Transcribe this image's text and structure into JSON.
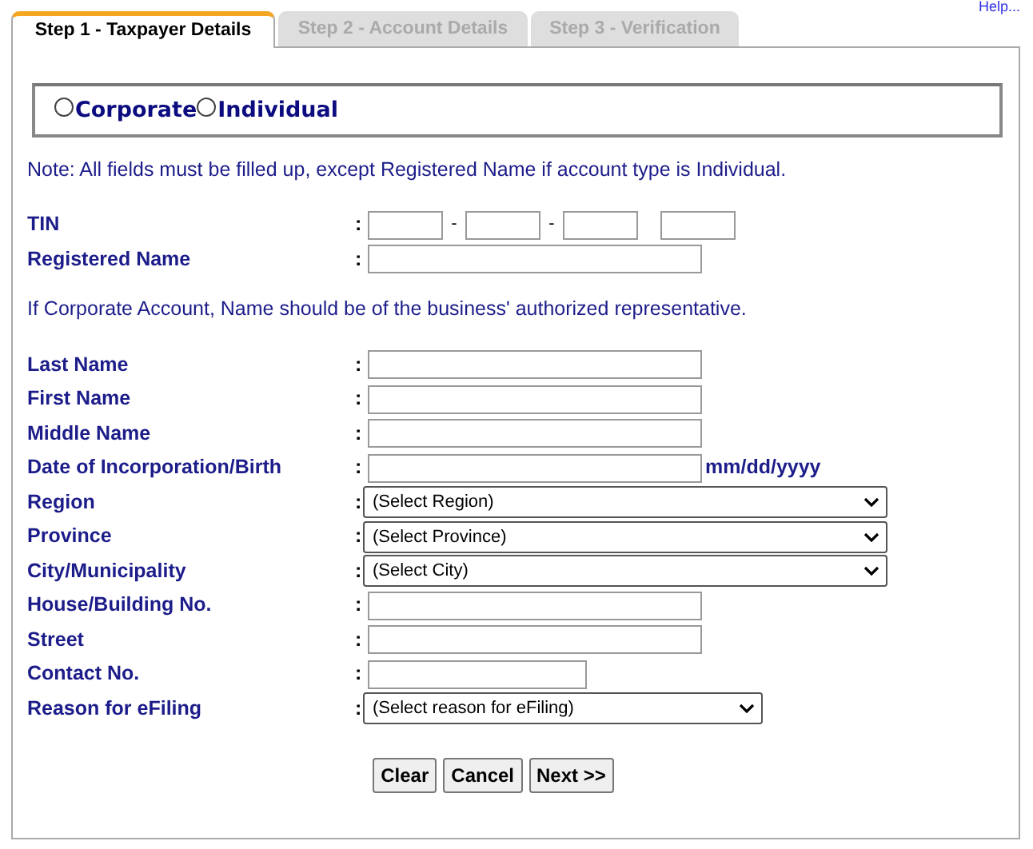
{
  "help_link": "Help...",
  "tabs": [
    {
      "label": "Step 1 - Taxpayer Details",
      "selected": true
    },
    {
      "label": "Step 2 - Account Details",
      "selected": false
    },
    {
      "label": "Step 3 - Verification",
      "selected": false
    }
  ],
  "account_types": [
    {
      "label": "Corporate",
      "selected": false
    },
    {
      "label": "Individual",
      "selected": false
    }
  ],
  "note": "Note: All fields must be filled up, except Registered Name if account type is Individual.",
  "sections": [
    {
      "fields": [
        {
          "label": "TIN",
          "kind": "tin",
          "separator": "-"
        },
        {
          "label": "Registered Name",
          "kind": "text"
        }
      ]
    },
    {
      "note": "If Corporate Account, Name should be of the business' authorized representative.",
      "fields": [
        {
          "label": "Last Name",
          "kind": "text"
        },
        {
          "label": "First Name",
          "kind": "text"
        },
        {
          "label": "Middle Name",
          "kind": "text"
        },
        {
          "label": "Date of Incorporation/Birth",
          "kind": "date",
          "hint": "mm/dd/yyyy"
        },
        {
          "label": "Region",
          "kind": "select",
          "value": "(Select Region)"
        },
        {
          "label": "Province",
          "kind": "select",
          "value": "(Select Province)"
        },
        {
          "label": "City/Municipality",
          "kind": "select",
          "value": "(Select City)"
        },
        {
          "label": "House/Building No.",
          "kind": "text"
        },
        {
          "label": "Street",
          "kind": "text"
        },
        {
          "label": "Contact No.",
          "kind": "short-text"
        },
        {
          "label": "Reason for eFiling",
          "kind": "short-select",
          "value": "(Select reason for eFiling)"
        }
      ]
    }
  ],
  "colon": ":",
  "buttons": [
    "Clear",
    "Cancel",
    "Next >>"
  ]
}
